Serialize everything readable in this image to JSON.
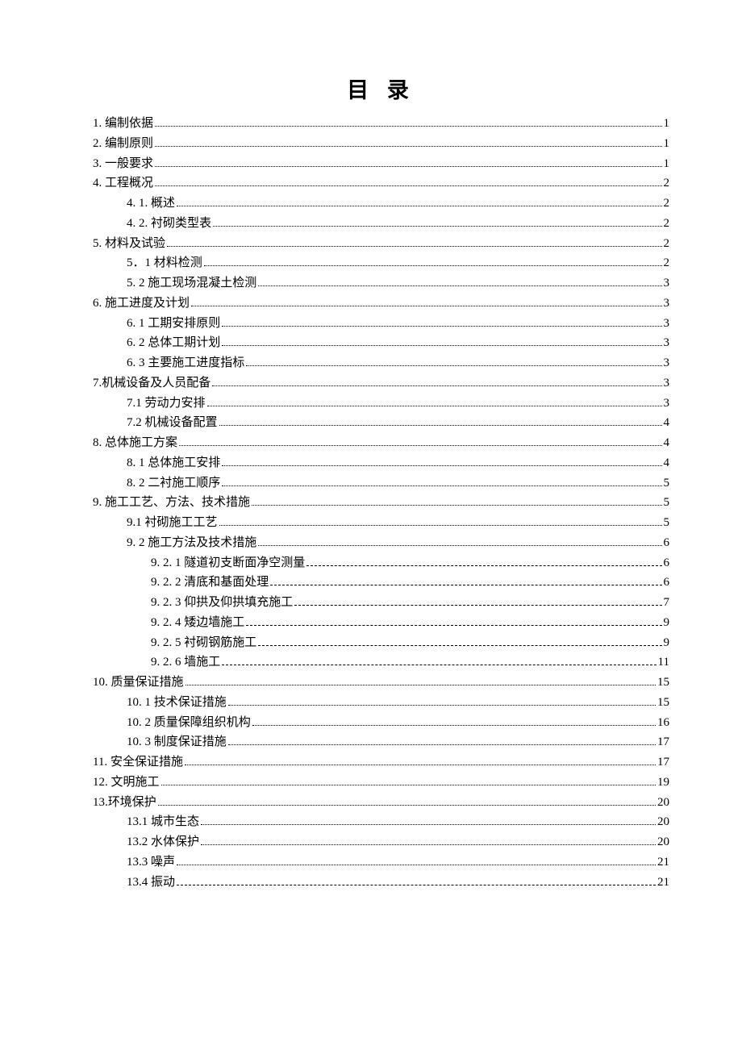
{
  "title": "目 录",
  "entries": [
    {
      "level": 0,
      "label": "1. 编制依据",
      "page": "1",
      "leader": "dot"
    },
    {
      "level": 0,
      "label": "2. 编制原则",
      "page": "1",
      "leader": "dot"
    },
    {
      "level": 0,
      "label": "3. 一般要求",
      "page": "1",
      "leader": "dot"
    },
    {
      "level": 0,
      "label": "4. 工程概况",
      "page": "2",
      "leader": "dot"
    },
    {
      "level": 1,
      "label": "4. 1.  概述",
      "page": "2",
      "leader": "dot"
    },
    {
      "level": 1,
      "label": "4. 2. 衬砌类型表",
      "page": "2",
      "leader": "dot"
    },
    {
      "level": 0,
      "label": "5.  材料及试验",
      "page": "2",
      "leader": "dot"
    },
    {
      "level": 1,
      "label": "5．1 材料检测",
      "page": "2",
      "leader": "dot"
    },
    {
      "level": 1,
      "label": "5. 2 施工现场混凝土检测",
      "page": "3",
      "leader": "dot"
    },
    {
      "level": 0,
      "label": "6.  施工进度及计划",
      "page": "3",
      "leader": "dot"
    },
    {
      "level": 1,
      "label": "6. 1 工期安排原则",
      "page": "3",
      "leader": "dot"
    },
    {
      "level": 1,
      "label": "6. 2 总体工期计划",
      "page": "3",
      "leader": "dot"
    },
    {
      "level": 1,
      "label": "6. 3 主要施工进度指标",
      "page": "3",
      "leader": "dot"
    },
    {
      "level": 0,
      "label": "7.机械设备及人员配备",
      "page": "3",
      "leader": "dot"
    },
    {
      "level": 1,
      "label": "7.1 劳动力安排",
      "page": "3",
      "leader": "dot"
    },
    {
      "level": 1,
      "label": "7.2 机械设备配置",
      "page": "4",
      "leader": "dot"
    },
    {
      "level": 0,
      "label": "8.  总体施工方案",
      "page": "4",
      "leader": "dot"
    },
    {
      "level": 1,
      "label": "8. 1 总体施工安排",
      "page": "4",
      "leader": "dot"
    },
    {
      "level": 1,
      "label": "8. 2 二衬施工顺序",
      "page": "5",
      "leader": "dot"
    },
    {
      "level": 0,
      "label": "9. 施工工艺、方法、技术措施",
      "page": "5",
      "leader": "dot"
    },
    {
      "level": 1,
      "label": "9.1 衬砌施工工艺",
      "page": "5",
      "leader": "dot"
    },
    {
      "level": 1,
      "label": "9. 2 施工方法及技术措施",
      "page": "6",
      "leader": "dot"
    },
    {
      "level": 2,
      "label": "9. 2. 1 隧道初支断面净空测量 ",
      "page": "6",
      "leader": "dash"
    },
    {
      "level": 2,
      "label": "9. 2. 2 清底和基面处理 ",
      "page": "6",
      "leader": "dash"
    },
    {
      "level": 2,
      "label": "9. 2. 3 仰拱及仰拱填充施工 ",
      "page": "7",
      "leader": "dash"
    },
    {
      "level": 2,
      "label": "9. 2. 4 矮边墙施工 ",
      "page": "9",
      "leader": "dash"
    },
    {
      "level": 2,
      "label": "9. 2. 5 衬砌钢筋施工 ",
      "page": "9",
      "leader": "dash"
    },
    {
      "level": 2,
      "label": "9. 2. 6 墙施工",
      "page": " 11",
      "leader": "dash"
    },
    {
      "level": 0,
      "label": "10. 质量保证措施",
      "page": "15",
      "leader": "dot"
    },
    {
      "level": 1,
      "label": "10. 1 技术保证措施",
      "page": "15",
      "leader": "dot"
    },
    {
      "level": 1,
      "label": "10. 2 质量保障组织机构",
      "page": "16",
      "leader": "dot"
    },
    {
      "level": 1,
      "label": "10. 3 制度保证措施",
      "page": "17",
      "leader": "dot"
    },
    {
      "level": 0,
      "label": "11. 安全保证措施",
      "page": "17",
      "leader": "dot"
    },
    {
      "level": 0,
      "label": "12. 文明施工",
      "page": "19",
      "leader": "dot"
    },
    {
      "level": 0,
      "label": "13.环境保护",
      "page": "20",
      "leader": "dot"
    },
    {
      "level": 1,
      "label": "13.1 城市生态 ",
      "page": "20",
      "leader": "dot"
    },
    {
      "level": 1,
      "label": "13.2 水体保护",
      "page": "20",
      "leader": "dot"
    },
    {
      "level": 1,
      "label": "13.3 噪声",
      "page": "21",
      "leader": "dot"
    },
    {
      "level": 1,
      "label": "13.4 振动 ",
      "page": "21",
      "leader": "dash"
    }
  ]
}
